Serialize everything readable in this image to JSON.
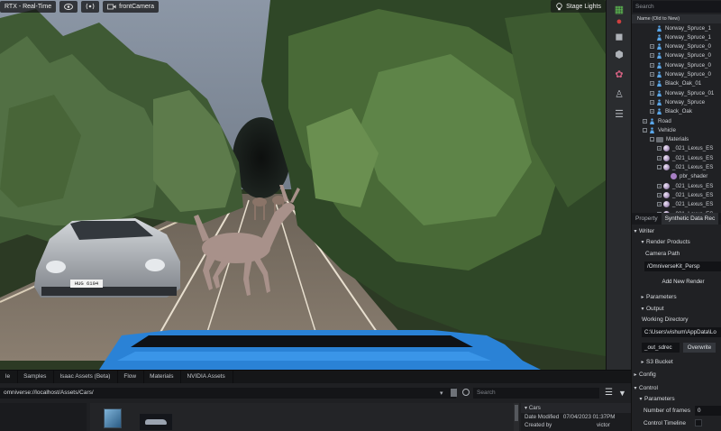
{
  "viewport": {
    "renderer_label": "RTX - Real-Time",
    "camera_label": "frontCamera",
    "stage_lights_label": "Stage Lights",
    "car_plate": "HUG 6104"
  },
  "stage": {
    "search_placeholder": "Search",
    "column_header": "Name (Old to New)",
    "items": [
      {
        "label": "Norway_Spruce_1",
        "icon": "person-icon",
        "depth": 2,
        "expander": ""
      },
      {
        "label": "Norway_Spruce_1",
        "icon": "person-icon",
        "depth": 2,
        "expander": ""
      },
      {
        "label": "Norway_Spruce_0",
        "icon": "person-icon",
        "depth": 2,
        "expander": "+"
      },
      {
        "label": "Norway_Spruce_0",
        "icon": "person-icon",
        "depth": 2,
        "expander": "+"
      },
      {
        "label": "Norway_Spruce_0",
        "icon": "person-icon",
        "depth": 2,
        "expander": "+"
      },
      {
        "label": "Norway_Spruce_0",
        "icon": "person-icon",
        "depth": 2,
        "expander": "+"
      },
      {
        "label": "Black_Oak_01",
        "icon": "person-icon",
        "depth": 2,
        "expander": "+"
      },
      {
        "label": "Norway_Spruce_01",
        "icon": "person-icon",
        "depth": 2,
        "expander": "+"
      },
      {
        "label": "Norway_Spruce",
        "icon": "person-icon",
        "depth": 2,
        "expander": "+"
      },
      {
        "label": "Black_Oak",
        "icon": "person-icon",
        "depth": 2,
        "expander": "+"
      },
      {
        "label": "Road",
        "icon": "person-icon",
        "depth": 1,
        "expander": "+"
      },
      {
        "label": "Vehicle",
        "icon": "person-icon",
        "depth": 1,
        "expander": "-"
      },
      {
        "label": "Materials",
        "icon": "folder-icon",
        "depth": 2,
        "expander": "-"
      },
      {
        "label": "_021_Lexus_ES",
        "icon": "sphere-icon",
        "depth": 3,
        "expander": "+"
      },
      {
        "label": "_021_Lexus_ES",
        "icon": "sphere-icon",
        "depth": 3,
        "expander": "+"
      },
      {
        "label": "_021_Lexus_ES",
        "icon": "sphere-icon",
        "depth": 3,
        "expander": "-"
      },
      {
        "label": "pbr_shader",
        "icon": "shader-icon",
        "depth": 4,
        "expander": ""
      },
      {
        "label": "_021_Lexus_ES",
        "icon": "sphere-icon",
        "depth": 3,
        "expander": "+"
      },
      {
        "label": "_021_Lexus_ES",
        "icon": "sphere-icon",
        "depth": 3,
        "expander": "+"
      },
      {
        "label": "_021_Lexus_ES",
        "icon": "sphere-icon",
        "depth": 3,
        "expander": "+"
      },
      {
        "label": "_021_Lexus_ES",
        "icon": "sphere-icon",
        "depth": 3,
        "expander": "+"
      }
    ]
  },
  "properties": {
    "tabs": [
      "Property",
      "Synthetic Data Rec"
    ],
    "active_tab": 1,
    "writer_label": "Writer",
    "render_products_label": "Render Products",
    "camera_path_label": "Camera Path",
    "camera_path_value": "/OmniverseKit_Persp",
    "add_render_label": "Add New Render",
    "parameters_label": "Parameters",
    "output_label": "Output",
    "working_directory_label": "Working Directory",
    "working_directory_value": "C:\\Users\\vishum\\AppData\\Lo",
    "out_folder_value": "_out_sdrec",
    "overwrite_label": "Overwrite",
    "s3_bucket_label": "S3 Bucket",
    "config_label": "Config",
    "control_label": "Control",
    "control_parameters_label": "Parameters",
    "number_of_frames_label": "Number of frames",
    "number_of_frames_value": "0",
    "control_timeline_label": "Control Timeline"
  },
  "content": {
    "tabs": [
      "le",
      "Samples",
      "Isaac Assets (Beta)",
      "Flow",
      "Materials",
      "NVIDIA Assets"
    ],
    "path_value": "omniverse://localhost/Assets/Cars/",
    "search_placeholder": "Search",
    "details_title": "Cars",
    "date_modified_label": "Date Modified",
    "date_modified_value": "07/04/2023 01:37PM",
    "created_by_label": "Created by",
    "created_by_value": "victor"
  }
}
